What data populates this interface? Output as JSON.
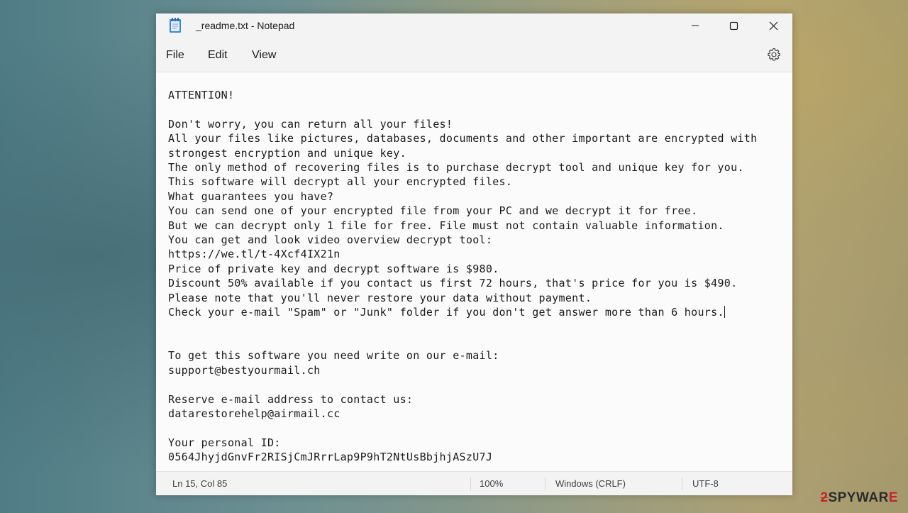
{
  "window": {
    "title": "_readme.txt - Notepad",
    "icon": "notepad-icon"
  },
  "menu": {
    "file": "File",
    "edit": "Edit",
    "view": "View"
  },
  "editor": {
    "lines": [
      "ATTENTION!",
      "",
      "Don't worry, you can return all your files!",
      "All your files like pictures, databases, documents and other important are encrypted with",
      "strongest encryption and unique key.",
      "The only method of recovering files is to purchase decrypt tool and unique key for you.",
      "This software will decrypt all your encrypted files.",
      "What guarantees you have?",
      "You can send one of your encrypted file from your PC and we decrypt it for free.",
      "But we can decrypt only 1 file for free. File must not contain valuable information.",
      "You can get and look video overview decrypt tool:",
      "https://we.tl/t-4Xcf4IX21n",
      "Price of private key and decrypt software is $980.",
      "Discount 50% available if you contact us first 72 hours, that's price for you is $490.",
      "Please note that you'll never restore your data without payment.",
      "Check your e-mail \"Spam\" or \"Junk\" folder if you don't get answer more than 6 hours.",
      "",
      "",
      "To get this software you need write on our e-mail:",
      "support@bestyourmail.ch",
      "",
      "Reserve e-mail address to contact us:",
      "datarestorehelp@airmail.cc",
      "",
      "Your personal ID:",
      "0564JhyjdGnvFr2RISjCmJRrrLap9P9hT2NtUsBbjhjASzU7J"
    ]
  },
  "status": {
    "position": "Ln 15, Col 85",
    "zoom": "100%",
    "line_ending": "Windows (CRLF)",
    "encoding": "UTF-8"
  },
  "watermark": {
    "prefix": "2",
    "text": "SPYWAR",
    "suffix": "E"
  },
  "colors": {
    "watermark_red": "#c8232a",
    "watermark_dark": "#2b2b2b"
  }
}
